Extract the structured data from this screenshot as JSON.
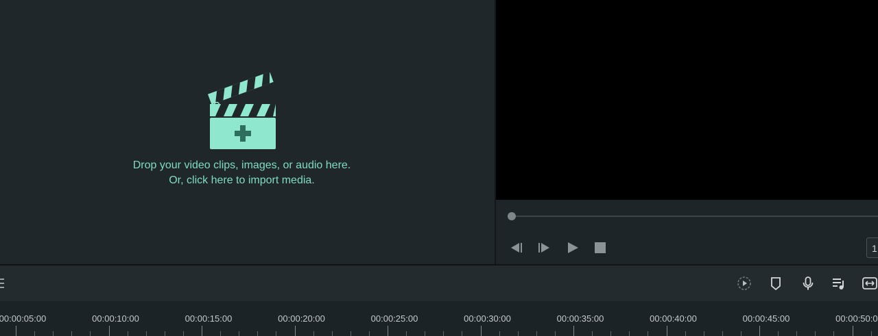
{
  "media_panel": {
    "drop_text_line1": "Drop your video clips, images, or audio here.",
    "drop_text_line2": "Or, click here to import media.",
    "icon": "clapperboard-add-icon",
    "accent_color": "#8fe8ce"
  },
  "preview": {
    "controls": [
      {
        "name": "prev-frame-button",
        "icon": "step-back-icon"
      },
      {
        "name": "next-frame-button",
        "icon": "step-forward-icon"
      },
      {
        "name": "play-button",
        "icon": "play-icon"
      },
      {
        "name": "stop-button",
        "icon": "stop-icon"
      }
    ],
    "zoom_value": "1"
  },
  "toolbar": {
    "tools": [
      {
        "name": "render-preview-button",
        "icon": "render-preview-icon"
      },
      {
        "name": "marker-button",
        "icon": "marker-icon"
      },
      {
        "name": "voiceover-button",
        "icon": "microphone-icon"
      },
      {
        "name": "audio-mixer-button",
        "icon": "music-list-icon"
      },
      {
        "name": "fit-timeline-button",
        "icon": "fit-width-icon"
      }
    ]
  },
  "timeline": {
    "ticks": [
      "00:00:05:00",
      "00:00:10:00",
      "00:00:15:00",
      "00:00:20:00",
      "00:00:25:00",
      "00:00:30:00",
      "00:00:35:00",
      "00:00:40:00",
      "00:00:45:00",
      "00:00:50:00"
    ]
  }
}
